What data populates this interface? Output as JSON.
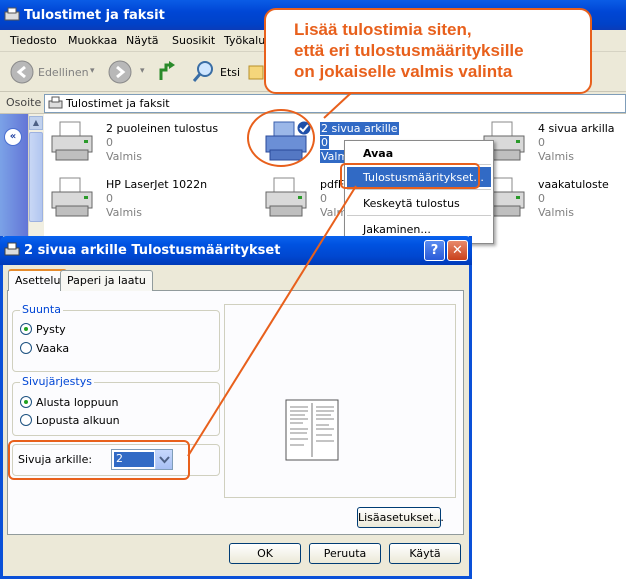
{
  "window": {
    "title": "Tulostimet ja faksit"
  },
  "menu": [
    "Tiedosto",
    "Muokkaa",
    "Näytä",
    "Suosikit",
    "Työkalu"
  ],
  "toolbar": {
    "back_label": "Edellinen",
    "search_label": "Etsi"
  },
  "address": {
    "label": "Osoite",
    "value": "Tulostimet ja faksit"
  },
  "printers": [
    {
      "name": "2 puoleinen tulostus",
      "count": "0",
      "status": "Valmis"
    },
    {
      "name": "2 sivua arkille",
      "count": "0",
      "status": "Valmis"
    },
    {
      "name": "4 sivua arkilla",
      "count": "0",
      "status": "Valmis"
    },
    {
      "name": "HP LaserJet 1022n",
      "count": "0",
      "status": "Valmis"
    },
    {
      "name": "pdfF",
      "count": "0",
      "status": "Valm"
    },
    {
      "name": "vaakatuloste",
      "count": "0",
      "status": "Valmis"
    }
  ],
  "context_menu": [
    {
      "label": "Avaa",
      "bold": true
    },
    {
      "label": "Tulostusmääritykset...",
      "selected": true
    },
    {
      "label": "Keskeytä tulostus"
    },
    {
      "label": "Jakaminen..."
    }
  ],
  "callout": {
    "lines": [
      "Lisää tulostimia siten,",
      "että eri tulostusmäärityksille",
      "on jokaiselle valmis valinta"
    ]
  },
  "dialog": {
    "title": "2 sivua arkille Tulostusmääritykset",
    "tabs": [
      "Asettelu",
      "Paperi ja laatu"
    ],
    "orientation": {
      "label": "Suunta",
      "options": [
        "Pysty",
        "Vaaka"
      ],
      "selected": "Pysty"
    },
    "page_order": {
      "label": "Sivujärjestys",
      "options": [
        "Alusta loppuun",
        "Lopusta alkuun"
      ],
      "selected": "Alusta loppuun"
    },
    "pages_per_sheet": {
      "label": "Sivuja arkille:",
      "value": "2"
    },
    "advanced_label": "Lisäasetukset...",
    "ok_label": "OK",
    "cancel_label": "Peruuta",
    "apply_label": "Käytä"
  },
  "colors": {
    "accent": "#e8601c",
    "xp_blue": "#0a50d8",
    "selection": "#316ac5"
  }
}
